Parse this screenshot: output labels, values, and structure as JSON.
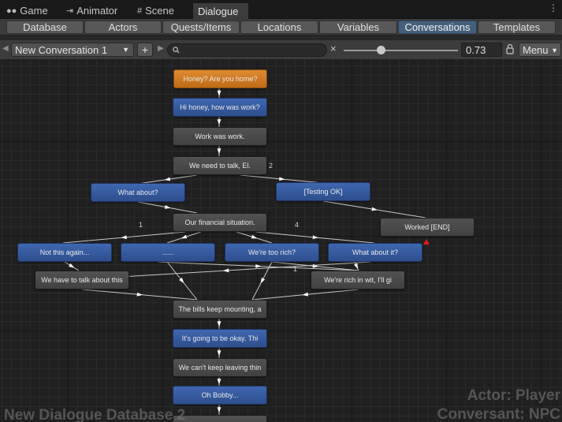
{
  "tabs": [
    {
      "label": "Game",
      "icon": "gamepad-icon"
    },
    {
      "label": "Animator",
      "icon": "animator-icon"
    },
    {
      "label": "Scene",
      "icon": "grid-icon"
    },
    {
      "label": "Dialogue",
      "icon": ""
    }
  ],
  "toolbar": {
    "items": [
      "Database",
      "Actors",
      "Quests/Items",
      "Locations",
      "Variables",
      "Conversations",
      "Templates"
    ],
    "active": "Conversations"
  },
  "conversation": {
    "selected": "New Conversation 1",
    "add_label": "+",
    "search_placeholder": "",
    "clear_label": "×",
    "zoom": "0.73",
    "zoom_fraction": 0.33,
    "menu_label": "Menu"
  },
  "nodes": [
    {
      "id": "n0",
      "text": "Honey? Are you home?",
      "kind": "orange"
    },
    {
      "id": "n1",
      "text": "Hi honey, how was work?",
      "kind": "blue"
    },
    {
      "id": "n2",
      "text": "Work was work.",
      "kind": "gray"
    },
    {
      "id": "n3",
      "text": "We need to talk, El.",
      "kind": "gray"
    },
    {
      "id": "n4",
      "text": "What about?",
      "kind": "blue"
    },
    {
      "id": "n5",
      "text": "[Testing OK]",
      "kind": "blue"
    },
    {
      "id": "n6",
      "text": "Our financial situation.",
      "kind": "gray"
    },
    {
      "id": "n7",
      "text": "Worked [END]",
      "kind": "gray"
    },
    {
      "id": "n8",
      "text": "Not this again...",
      "kind": "blue"
    },
    {
      "id": "n9",
      "text": "......",
      "kind": "blue"
    },
    {
      "id": "n10",
      "text": "We're too rich?",
      "kind": "blue"
    },
    {
      "id": "n11",
      "text": "What about it?",
      "kind": "blue"
    },
    {
      "id": "n12",
      "text": "We have to talk about this",
      "kind": "gray"
    },
    {
      "id": "n13",
      "text": "We're rich in wit, I'll gi",
      "kind": "gray"
    },
    {
      "id": "n14",
      "text": "The bills keep mounting, a",
      "kind": "gray"
    },
    {
      "id": "n15",
      "text": "It's going to be okay. Thi",
      "kind": "blue"
    },
    {
      "id": "n16",
      "text": "We can't keep leaving thin",
      "kind": "gray"
    },
    {
      "id": "n17",
      "text": "Oh Bobby...",
      "kind": "blue"
    }
  ],
  "link_counts": [
    {
      "label": "2"
    },
    {
      "label": "1"
    },
    {
      "label": "4"
    },
    {
      "label": "1"
    }
  ],
  "watermark": {
    "database": "New Dialogue Database 2",
    "actor": "Actor: Player",
    "conversant": "Conversant: NPC"
  }
}
